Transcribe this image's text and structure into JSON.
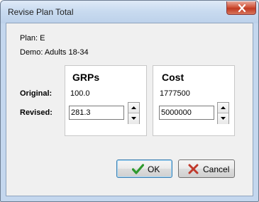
{
  "window": {
    "title": "Revise Plan Total"
  },
  "info": {
    "plan": "Plan: E",
    "demo": "Demo: Adults 18-34"
  },
  "rows": {
    "original_label": "Original:",
    "revised_label": "Revised:"
  },
  "grps": {
    "header": "GRPs",
    "original": "100.0",
    "revised": "281.3"
  },
  "cost": {
    "header": "Cost",
    "original": "1777500",
    "revised": "5000000"
  },
  "buttons": {
    "ok_label": "OK",
    "cancel_label": "Cancel"
  },
  "icons": {
    "ok": "green-check-icon",
    "cancel": "red-x-icon",
    "close": "close-icon"
  },
  "colors": {
    "ok_icon": "#2e9a2e",
    "cancel_icon": "#c0392b",
    "close_button": "#c74a31"
  }
}
